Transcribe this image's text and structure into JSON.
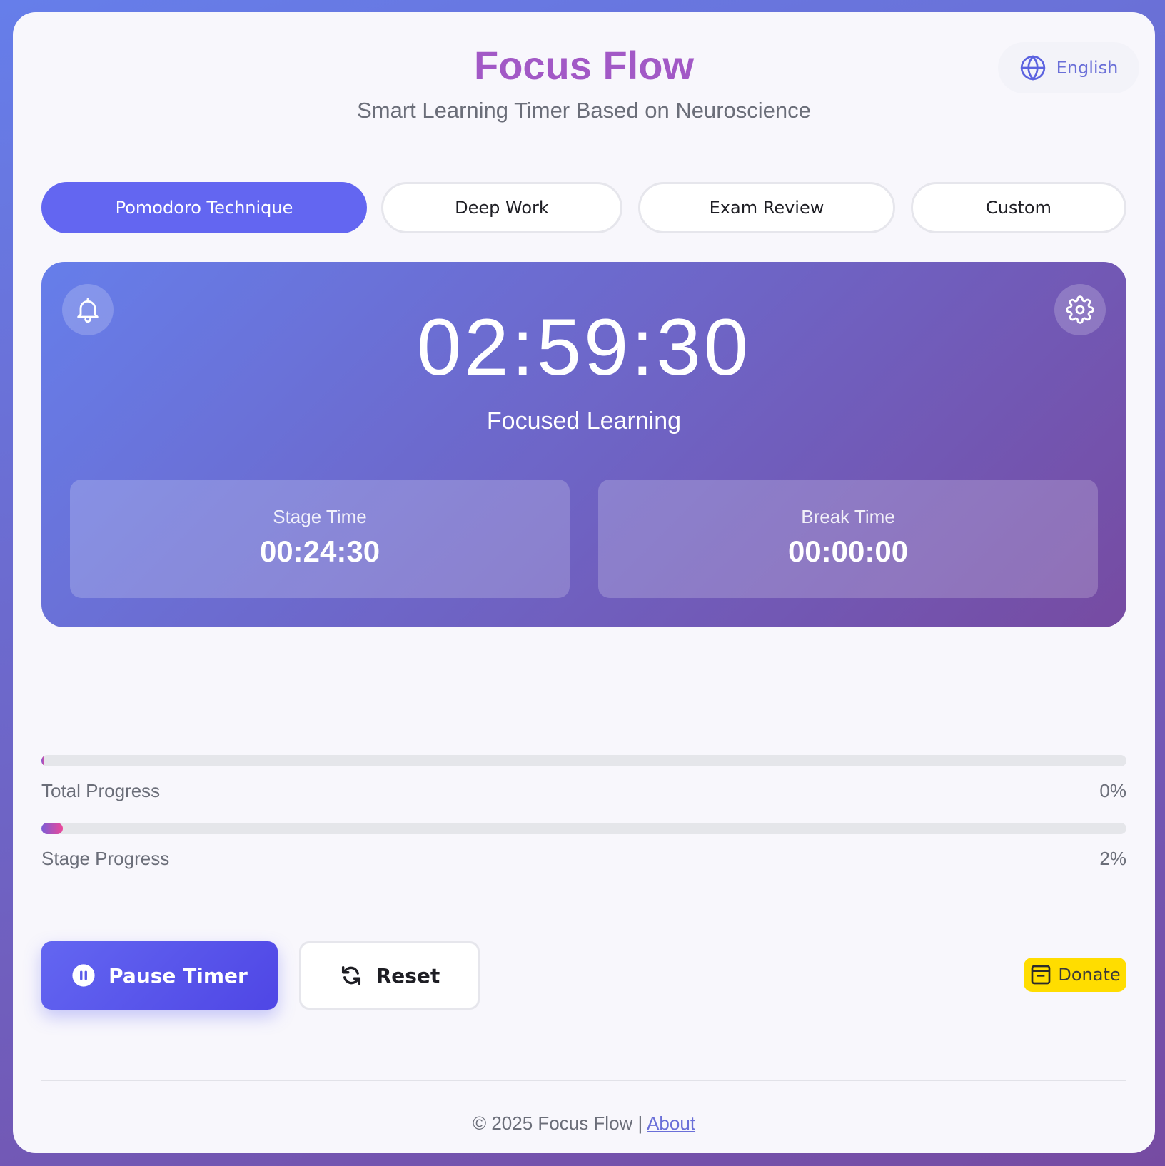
{
  "header": {
    "title": "Focus Flow",
    "subtitle": "Smart Learning Timer Based on Neuroscience",
    "language_label": "English",
    "language_icon": "globe-icon"
  },
  "tabs": [
    {
      "label": "Pomodoro Technique",
      "active": true
    },
    {
      "label": "Deep Work",
      "active": false
    },
    {
      "label": "Exam Review",
      "active": false
    },
    {
      "label": "Custom",
      "active": false
    }
  ],
  "timer": {
    "clock": "02:59:30",
    "mode_label": "Focused Learning",
    "stage_time_label": "Stage Time",
    "stage_time_value": "00:24:30",
    "break_time_label": "Break Time",
    "break_time_value": "00:00:00",
    "left_icon": "bell-icon",
    "right_icon": "gear-icon"
  },
  "progress": {
    "total_label": "Total Progress",
    "total_pct_text": "0%",
    "total_fraction": 0.0,
    "stage_label": "Stage Progress",
    "stage_pct_text": "2%",
    "stage_fraction": 0.02
  },
  "controls": {
    "pause_label": "Pause Timer",
    "pause_icon": "pause-icon",
    "reset_label": "Reset",
    "reset_icon": "refresh-icon",
    "donate_label": "Donate",
    "donate_icon": "coffee-cup-icon"
  },
  "footer": {
    "copyright": "© 2025 Focus Flow | ",
    "about_link": "About"
  },
  "colors": {
    "accent": "#6366f1",
    "title": "#a259c6",
    "panel_gradient_start": "#667eea",
    "panel_gradient_end": "#764ba2",
    "donate": "#ffdd00"
  }
}
